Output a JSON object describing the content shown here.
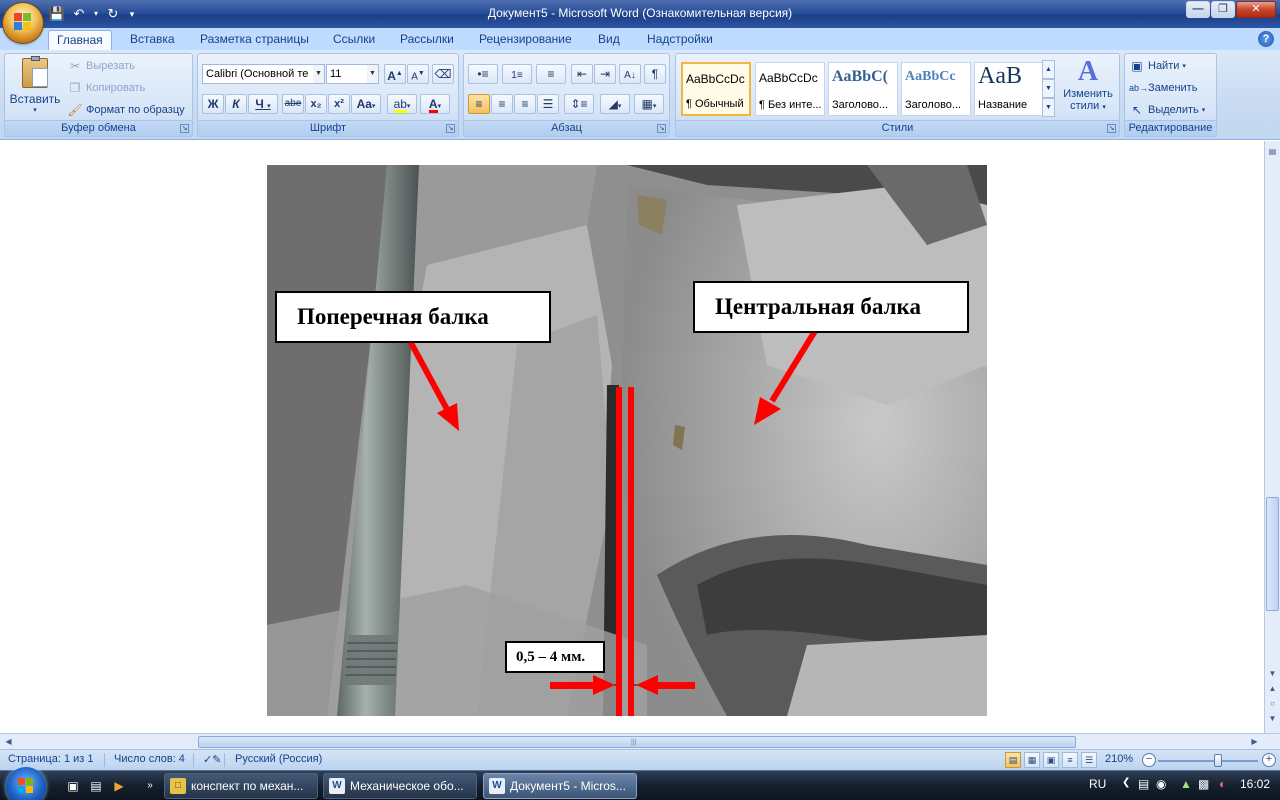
{
  "window": {
    "title": "Документ5 - Microsoft Word (Ознакомительная версия)"
  },
  "ribbon": {
    "tabs": [
      "Главная",
      "Вставка",
      "Разметка страницы",
      "Ссылки",
      "Рассылки",
      "Рецензирование",
      "Вид",
      "Надстройки"
    ],
    "active_tab": "Главная",
    "clipboard": {
      "label": "Буфер обмена",
      "paste": "Вставить",
      "cut": "Вырезать",
      "copy": "Копировать",
      "format_painter": "Формат по образцу"
    },
    "font": {
      "label": "Шрифт",
      "font_name": "Calibri (Основной те",
      "font_size": "11",
      "bold": "Ж",
      "italic": "К",
      "underline": "Ч",
      "strike": "abe",
      "subscript": "x₂",
      "superscript": "x²",
      "change_case": "Aa",
      "grow": "A",
      "shrink": "A"
    },
    "paragraph": {
      "label": "Абзац"
    },
    "styles": {
      "label": "Стили",
      "items": [
        {
          "sample": "AaBbCcDc",
          "name": "¶ Обычный"
        },
        {
          "sample": "AaBbCcDc",
          "name": "¶ Без инте..."
        },
        {
          "sample": "AaBbC(",
          "name": "Заголово..."
        },
        {
          "sample": "AaBbCc",
          "name": "Заголово..."
        },
        {
          "sample": "AaB",
          "name": "Название"
        }
      ],
      "change_styles_1": "Изменить",
      "change_styles_2": "стили"
    },
    "editing": {
      "label": "Редактирование",
      "find": "Найти",
      "replace": "Заменить",
      "select": "Выделить"
    }
  },
  "document": {
    "callout_left": "Поперечная  балка",
    "callout_right": "Центральная  балка",
    "callout_gap": "0,5 – 4 мм."
  },
  "statusbar": {
    "page": "Страница: 1 из 1",
    "words": "Число слов: 4",
    "language": "Русский (Россия)",
    "zoom": "210%"
  },
  "taskbar": {
    "items": [
      {
        "label": "конспект по механ...",
        "active": false
      },
      {
        "label": "Механическое обо...",
        "active": false
      },
      {
        "label": "Документ5 - Micros...",
        "active": true
      }
    ],
    "lang": "RU",
    "clock": "16:02"
  },
  "colors": {
    "ribbon_bg": "#c9dbf2",
    "titlebar": "#2a4f9a",
    "arrow_red": "#ff0000",
    "taskbar": "#15202f"
  }
}
